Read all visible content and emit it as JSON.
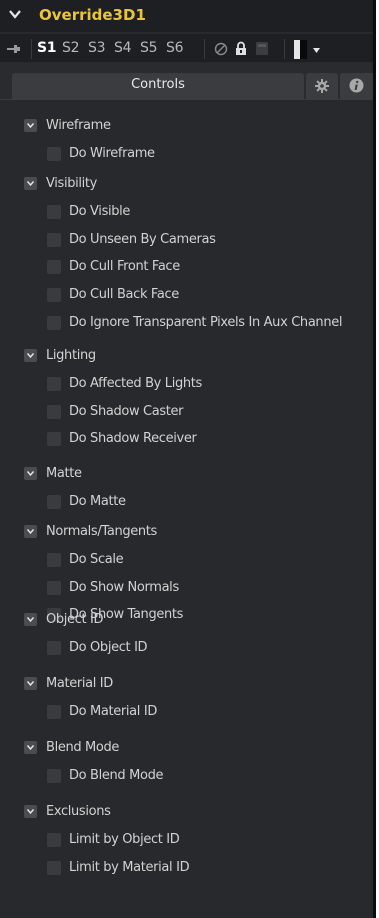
{
  "header": {
    "title": "Override3D1"
  },
  "toolbar": {
    "slots": [
      "S1",
      "S2",
      "S3",
      "S4",
      "S5",
      "S6"
    ],
    "active_slot": "S1"
  },
  "tabs": {
    "controls_label": "Controls",
    "gear_icon": "gear-icon",
    "info_icon": "info-icon"
  },
  "colors": {
    "title": "#e8c53c",
    "panel_bg": "#28292c",
    "bar_bg": "#1e1f22",
    "checkbox": "#3a3b3e"
  },
  "sections": [
    {
      "label": "Wireframe",
      "options": [
        "Do Wireframe"
      ]
    },
    {
      "label": "Visibility",
      "options": [
        "Do Visible",
        "Do Unseen By Cameras",
        "Do Cull Front Face",
        "Do Cull Back Face",
        "Do Ignore Transparent Pixels In Aux Channel"
      ]
    },
    {
      "label": "Lighting",
      "options": [
        "Do Affected By Lights",
        "Do Shadow Caster",
        "Do Shadow Receiver"
      ]
    },
    {
      "label": "Matte",
      "options": [
        "Do Matte"
      ]
    },
    {
      "label": "Normals/Tangents",
      "options": [
        "Do Scale",
        "Do Show Normals",
        "Do Show Tangents"
      ]
    },
    {
      "label": "Object ID",
      "options": [
        "Do Object ID"
      ]
    },
    {
      "label": "Material ID",
      "options": [
        "Do Material ID"
      ]
    },
    {
      "label": "Blend Mode",
      "options": [
        "Do Blend Mode"
      ]
    },
    {
      "label": "Exclusions",
      "options": [
        "Limit by Object ID",
        "Limit by Material ID"
      ]
    }
  ]
}
